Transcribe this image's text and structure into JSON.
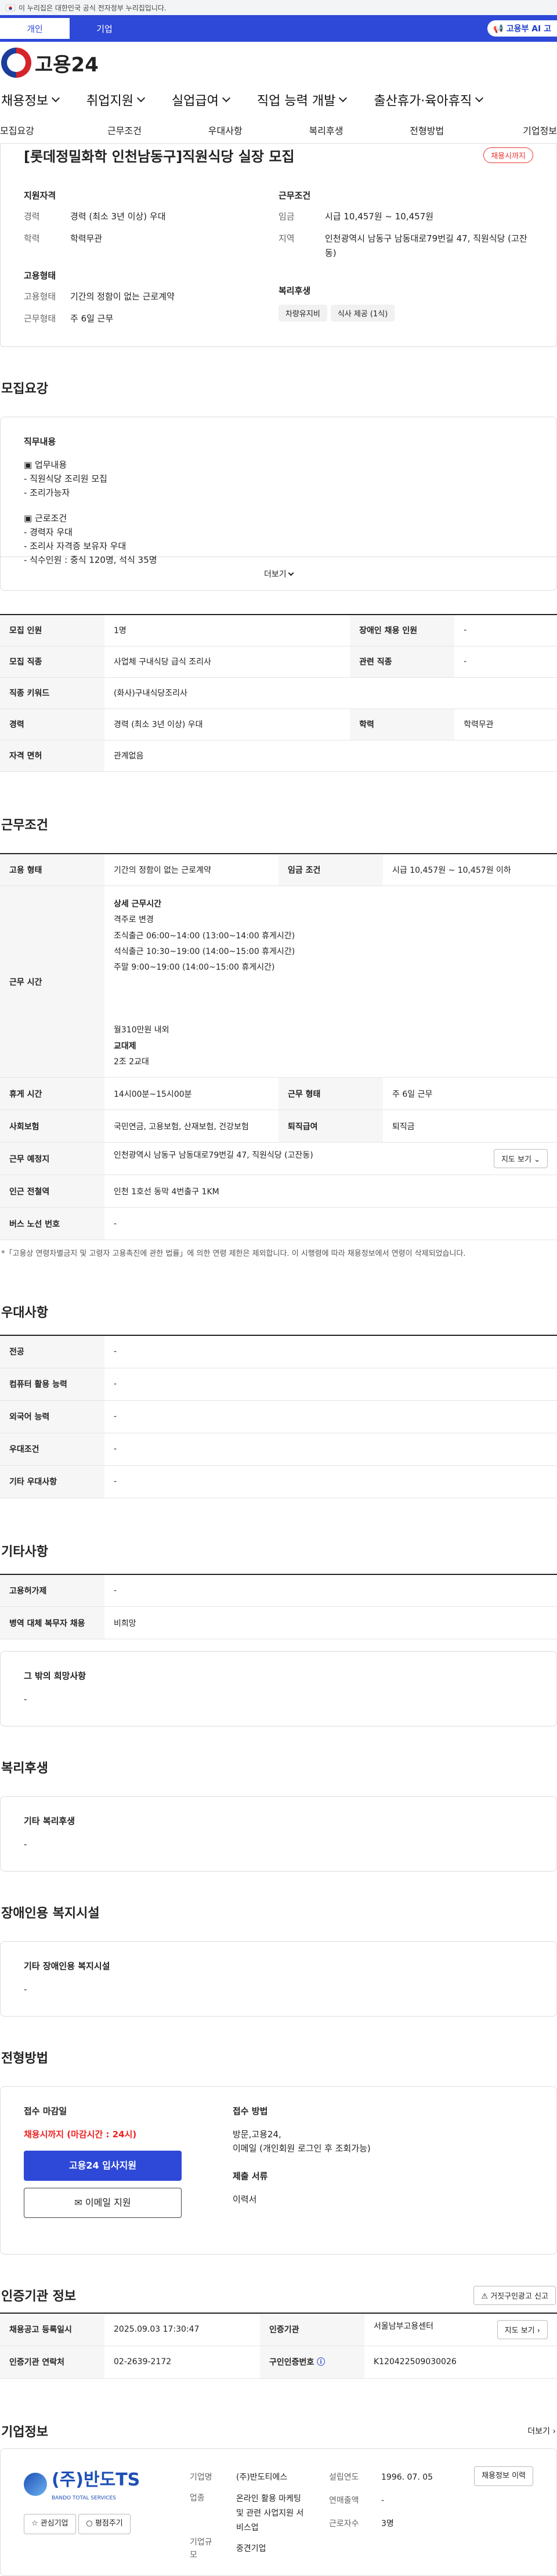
{
  "gov_banner": "이 누리집은 대한민국 공식 전자정부 누리집입니다.",
  "top_tabs": [
    "개인",
    "기업"
  ],
  "moel": "고용부 AI 고",
  "logo": "고용24",
  "gnb": [
    "채용정보",
    "취업지원",
    "실업급여",
    "직업 능력 개발",
    "출산휴가·육아휴직"
  ],
  "subtabs": [
    "모집요강",
    "근무조건",
    "우대사항",
    "복리후생",
    "전형방법",
    "기업정보"
  ],
  "title": "[롯데정밀화학 인천남동구]직원식당 실장 모집",
  "deadline_badge": "채용시까지",
  "summary": {
    "qual_h": "지원자격",
    "career_k": "경력",
    "career_v": "경력 (최소 3년 이상) 우대",
    "edu_k": "학력",
    "edu_v": "학력무관",
    "emp_h": "고용형태",
    "emptype_k": "고용형태",
    "emptype_v": "기간의 정함이 없는 근로계약",
    "worktype_k": "근무형태",
    "worktype_v": "주 6일 근무",
    "cond_h": "근무조건",
    "wage_k": "임금",
    "wage_v": "시급 10,457원 ~ 10,457원",
    "area_k": "지역",
    "area_v": "인천광역시 남동구 남동대로79번길 47, 직원식당 (고잔동)",
    "welfare_h": "복리후생",
    "chips": [
      "차량유지비",
      "식사 제공 (1식)"
    ]
  },
  "recruit": {
    "h": "모집요강",
    "lab": "직무내용",
    "lines": [
      "▣ 업무내용",
      "- 직원식당 조리원 모집",
      "- 조리가능자",
      "",
      "▣ 근로조건",
      "- 경력자 우대",
      "- 조리사 자격증 보유자 우대",
      "- 식수인원 : 중식 120명, 석식 35명"
    ],
    "more": "더보기"
  },
  "recruit_tbl": {
    "r1": [
      "모집 인원",
      "1명",
      "장애인 채용 인원",
      "-"
    ],
    "r2": [
      "모집 직종",
      "사업체 구내식당 급식 조리사",
      "관련 직종",
      "-"
    ],
    "r3": [
      "직종 키워드",
      "(화사)구내식당조리사"
    ],
    "r4": [
      "경력",
      "경력 (최소 3년 이상) 우대",
      "학력",
      "학력무관"
    ],
    "r5": [
      "자격 면허",
      "관계없음"
    ]
  },
  "work": {
    "h": "근무조건",
    "r1": [
      "고용 형태",
      "기간의 정함이 없는 근로계약",
      "임금 조건",
      "시급 10,457원 ~ 10,457원 이하"
    ],
    "time_k": "근무 시간",
    "time_lines": [
      "상세 근무시간",
      "격주로 변경",
      "조식출근 06:00~14:00 (13:00~14:00 휴게시간)",
      "석식출근 10:30~19:00 (14:00~15:00 휴게시간)",
      "주말 9:00~19:00 (14:00~15:00 휴게시간)",
      "",
      "",
      "",
      "월310만원 내외",
      "교대제",
      "2조 2교대"
    ],
    "r3": [
      "휴게 시간",
      "14시00분~15시00분",
      "근무 형태",
      "주 6일 근무"
    ],
    "r4": [
      "사회보험",
      "국민연금, 고용보험, 산재보험, 건강보험",
      "퇴직급여",
      "퇴직금"
    ],
    "r5": [
      "근무 예정지",
      "인천광역시 남동구 남동대로79번길 47, 직원식당 (고잔동)"
    ],
    "map_btn": "지도 보기",
    "r6": [
      "인근 전철역",
      "인천 1호선 동막 4번출구 1KM"
    ],
    "r7": [
      "버스 노선 번호",
      "-"
    ],
    "note": "*「고용상 연령차별금지 및 고령자 고용촉진에 관한 법률」에 의한 연령 제한은 제외합니다. 이 시행령에 따라 채용정보에서 연령이 삭제되었습니다."
  },
  "pref": {
    "h": "우대사항",
    "rows": [
      [
        "전공",
        "-"
      ],
      [
        "컴퓨터 활용 능력",
        "-"
      ],
      [
        "외국어 능력",
        "-"
      ],
      [
        "우대조건",
        "-"
      ],
      [
        "기타 우대사항",
        "-"
      ]
    ]
  },
  "etc": {
    "h": "기타사항",
    "rows": [
      [
        "고용허가제",
        "-"
      ],
      [
        "병역 대체 복무자 채용",
        "비희망"
      ]
    ],
    "lab": "그 밖의 희망사항",
    "val": "-"
  },
  "welfare": {
    "h": "복리후생",
    "lab": "기타 복리후생",
    "val": "-"
  },
  "disab": {
    "h": "장애인용 복지시설",
    "lab": "기타 장애인용 복지시설",
    "val": "-"
  },
  "apply": {
    "h": "전형방법",
    "lab": "접수 마감일",
    "deadline": "채용시까지 (마감시간 : 24시)",
    "btn1": "고용24 입사지원",
    "btn2": "이메일 지원",
    "method_h": "접수 방법",
    "method_v": "방문,고용24,\n이메일 (개인회원 로그인 후 조회가능)",
    "docs_h": "제출 서류",
    "docs_v": "이력서"
  },
  "cert": {
    "h": "인증기관 정보",
    "report_btn": "거짓구인광고 신고",
    "r1": [
      "채용공고 등록일시",
      "2025.09.03 17:30:47",
      "인증기관",
      "서울남부고용센터"
    ],
    "view_btn": "지도 보기",
    "r2": [
      "인증기관 연락처",
      "02-2639-2172",
      "구인인증번호",
      "K120422509030026"
    ]
  },
  "company": {
    "h": "기업정보",
    "more": "더보기",
    "logo_name": "(주)반도TS",
    "logo_sub": "BANDO TOTAL SERVICES",
    "fav": "관심기업",
    "fav2": "평점주기",
    "rows": [
      [
        "기업명",
        "(주)반도티에스",
        "설립연도",
        "1996. 07. 05"
      ],
      [
        "업종",
        "온라인 활용 마케팅 및 관련 사업지원 서비스업",
        "연매출액",
        "-"
      ],
      [
        "",
        "",
        "근로자수",
        "3명"
      ],
      [
        "기업규모",
        "중견기업",
        "",
        ""
      ]
    ],
    "hist_btn": "채용정보 이력"
  }
}
